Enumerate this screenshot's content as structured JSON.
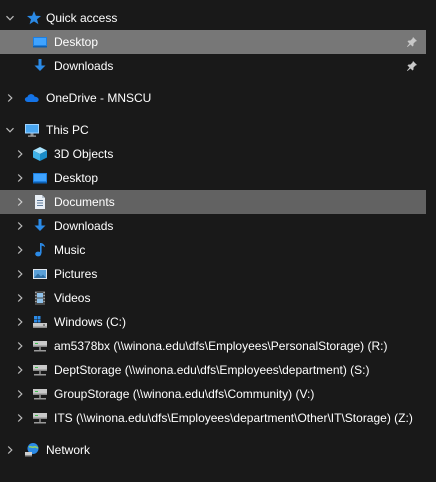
{
  "navigation_pane": {
    "quick_access": {
      "label": "Quick access",
      "items": [
        {
          "label": "Desktop",
          "pinned": true
        },
        {
          "label": "Downloads",
          "pinned": true
        }
      ]
    },
    "onedrive": {
      "label": "OneDrive - MNSCU"
    },
    "this_pc": {
      "label": "This PC",
      "items": [
        {
          "label": "3D Objects"
        },
        {
          "label": "Desktop"
        },
        {
          "label": "Documents"
        },
        {
          "label": "Downloads"
        },
        {
          "label": "Music"
        },
        {
          "label": "Pictures"
        },
        {
          "label": "Videos"
        },
        {
          "label": "Windows (C:)"
        },
        {
          "label": "am5378bx (\\\\winona.edu\\dfs\\Employees\\PersonalStorage) (R:)"
        },
        {
          "label": "DeptStorage (\\\\winona.edu\\dfs\\Employees\\department) (S:)"
        },
        {
          "label": "GroupStorage (\\\\winona.edu\\dfs\\Community) (V:)"
        },
        {
          "label": "ITS (\\\\winona.edu\\dfs\\Employees\\department\\Other\\IT\\Storage) (Z:)"
        }
      ]
    },
    "network": {
      "label": "Network"
    }
  },
  "icons": {
    "quick_access": "star-icon",
    "desktop": "desktop-icon",
    "downloads": "download-arrow-icon",
    "onedrive": "cloud-icon",
    "this_pc": "monitor-icon",
    "objects_3d": "cube-icon",
    "documents": "document-icon",
    "music": "music-note-icon",
    "pictures": "picture-icon",
    "videos": "film-icon",
    "windows_drive": "hard-drive-icon",
    "network_drive": "network-drive-icon",
    "network": "network-globe-icon",
    "pin": "pin-icon"
  },
  "colors": {
    "background": "#191919",
    "selected_row": "#777777",
    "hover_row": "#626262",
    "text": "#ffffff",
    "accent_blue": "#2b8ae6"
  }
}
